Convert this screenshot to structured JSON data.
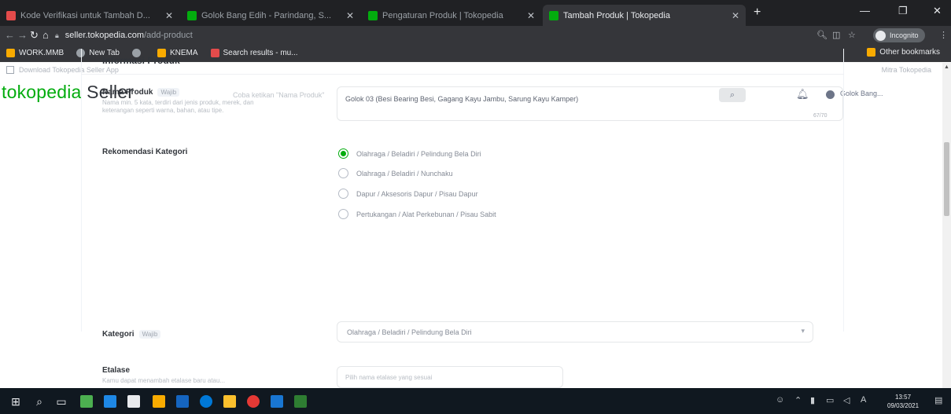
{
  "browser": {
    "tabs": [
      {
        "label": "Kode Verifikasi untuk Tambah D...",
        "color": "#e34b4b"
      },
      {
        "label": "Golok Bang Edih - Parindang, S...",
        "color": "#03ac0e"
      },
      {
        "label": "Pengaturan Produk | Tokopedia",
        "color": "#03ac0e"
      },
      {
        "label": "Tambah Produk | Tokopedia",
        "color": "#03ac0e",
        "active": true
      }
    ],
    "new_tab_glyph": "+",
    "window_controls": [
      "—",
      "❐",
      "✕"
    ],
    "url_host": "seller.tokopedia.com",
    "url_path": "/add-product",
    "incognito_label": "Incognito",
    "bookmarks": [
      {
        "label": "WORK.MMB",
        "color": "#f9ab00"
      },
      {
        "label": "New Tab",
        "color": "#9aa0a6"
      },
      {
        "label": "",
        "color": "#9aa0a6"
      },
      {
        "label": "KNEMA",
        "color": "#f9ab00"
      },
      {
        "label": "Search results - mu...",
        "color": "#e34b4b"
      }
    ],
    "other_bookmarks": "Other bookmarks"
  },
  "page": {
    "download_bar": "Download Tokopedia Seller App",
    "mitra_link": "Mitra Tokopedia",
    "brand": {
      "name": "tokopedia",
      "suffix": "Seller",
      "color": "#03ac0e"
    },
    "search_placeholder": "Coba ketikan \"Nama Produk\"",
    "shop_name": "Golok Bang...",
    "section_title": "Informasi Produk",
    "badge_required": "Wajib",
    "product_name": {
      "label": "Nama Produk",
      "description": "Nama min. 5 kata, terdiri dari jenis produk, merek, dan keterangan seperti warna, bahan, atau tipe.",
      "value": "Golok 03 (Besi Bearing Besi, Gagang Kayu Jambu, Sarung Kayu Kamper)",
      "counter": "67/70"
    },
    "category_recommendation": {
      "label": "Rekomendasi Kategori",
      "options": [
        {
          "label": "Olahraga / Beladiri / Pelindung Bela Diri",
          "selected": true
        },
        {
          "label": "Olahraga / Beladiri / Nunchaku",
          "selected": false
        },
        {
          "label": "Dapur / Aksesoris Dapur / Pisau Dapur",
          "selected": false
        },
        {
          "label": "Pertukangan / Alat Perkebunan / Pisau Sabit",
          "selected": false
        }
      ]
    },
    "category": {
      "label": "Kategori",
      "value": "Olahraga / Beladiri / Pelindung Bela Diri"
    },
    "etalase": {
      "label": "Etalase",
      "description": "Kamu dapat menambah etalase baru atau...",
      "placeholder": "Pilih nama etalase yang sesuai"
    }
  },
  "taskbar": {
    "time": "13:57",
    "date": "09/03/2021"
  }
}
